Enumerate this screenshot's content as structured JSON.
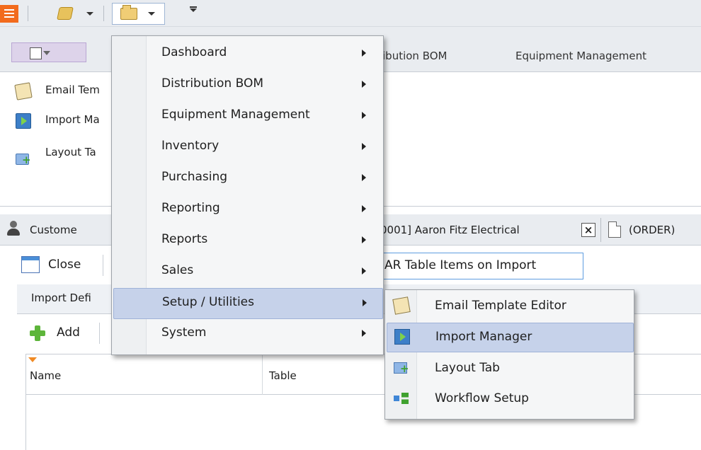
{
  "ribbon_tabs": [
    "ibution BOM",
    "Equipment Management"
  ],
  "ribbon_items": [
    {
      "label": "Email Tem",
      "icon": "email-template-icon"
    },
    {
      "label": "Import Ma",
      "icon": "import-manager-icon"
    },
    {
      "label": "Layout Ta",
      "icon": "layout-tab-icon"
    }
  ],
  "doc_tabs": {
    "customer_label": "Custome",
    "account_label": "0001] Aaron Fitz Electrical",
    "order_label": "(ORDER)"
  },
  "toolbar": {
    "close_label": "Close",
    "ar_label": "AR Table Items on Import",
    "subtab_label": "Import Defi",
    "add_label": "Add"
  },
  "grid": {
    "columns": [
      "Name",
      "Table"
    ]
  },
  "main_menu": {
    "items": [
      {
        "label": "Dashboard",
        "submenu": true
      },
      {
        "label": "Distribution BOM",
        "submenu": true
      },
      {
        "label": "Equipment Management",
        "submenu": true
      },
      {
        "label": "Inventory",
        "submenu": true
      },
      {
        "label": "Purchasing",
        "submenu": true
      },
      {
        "label": "Reporting",
        "submenu": true
      },
      {
        "label": "Reports",
        "submenu": true
      },
      {
        "label": "Sales",
        "submenu": true
      },
      {
        "label": "Setup / Utilities",
        "submenu": true,
        "highlighted": true
      },
      {
        "label": "System",
        "submenu": true
      }
    ]
  },
  "submenu": {
    "items": [
      {
        "label": "Email Template Editor",
        "icon": "email-template-icon"
      },
      {
        "label": "Import Manager",
        "icon": "import-manager-icon",
        "highlighted": true
      },
      {
        "label": "Layout Tab",
        "icon": "layout-tab-icon"
      },
      {
        "label": "Workflow Setup",
        "icon": "workflow-icon"
      }
    ]
  },
  "colors": {
    "app_button": "#f26b1d",
    "menu_highlight": "#c6d2ea",
    "accent_border": "#5e9de0"
  }
}
